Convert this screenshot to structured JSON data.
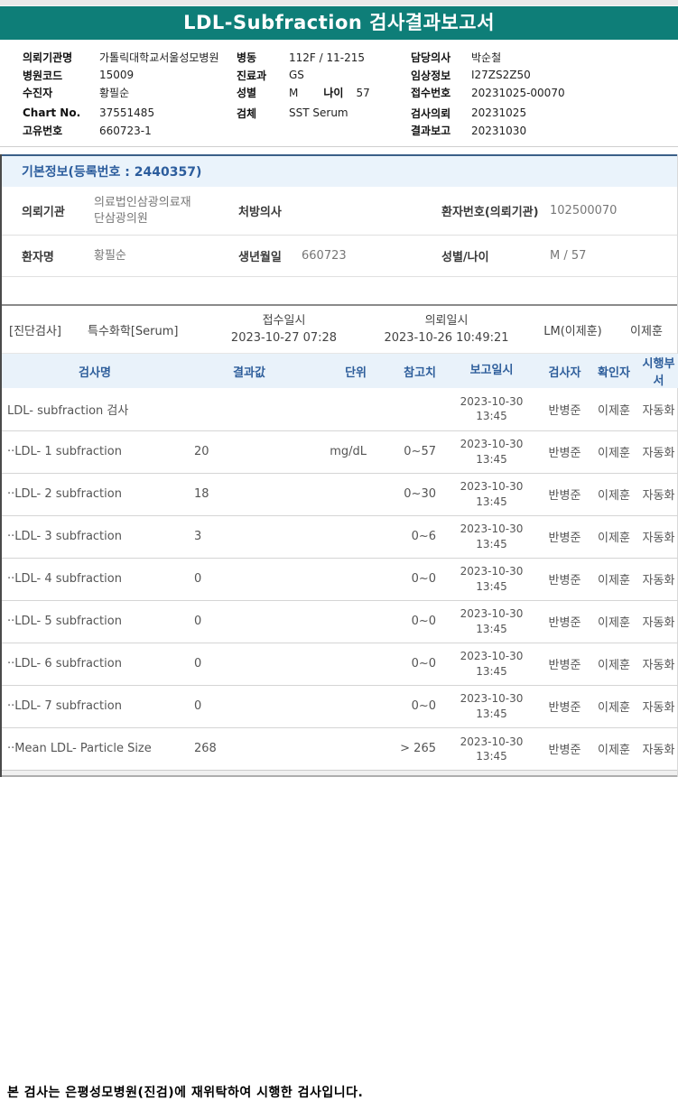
{
  "colors": {
    "teal_bar": "#0E7E78",
    "section_band_bg": "#EAF3FB",
    "section_band_text": "#2C5D9D",
    "table_header_bg": "#E9F2FA",
    "table_header_text": "#2E5E9B"
  },
  "title_bar": {
    "title": "LDL-Subfraction 검사결과보고서"
  },
  "patient_header": {
    "col1": [
      {
        "label": "의뢰기관명",
        "value": "가톨릭대학교서울성모병원"
      },
      {
        "label": "병원코드",
        "value": "15009"
      },
      {
        "label": "수진자",
        "value": "황필순"
      },
      {
        "label": "Chart No.",
        "value": "37551485"
      },
      {
        "label": "고유번호",
        "value": "660723-1"
      }
    ],
    "col2": [
      {
        "label": "병동",
        "value": "112F / 11-215"
      },
      {
        "label": "진료과",
        "value": "GS"
      },
      {
        "label": "성별",
        "value": "M",
        "label2": "나이",
        "value2": "57"
      },
      {
        "label": "검체",
        "value": "SST Serum"
      }
    ],
    "col3": [
      {
        "label": "담당의사",
        "value": "박순철"
      },
      {
        "label": "임상정보",
        "value": "I27ZS2Z50"
      },
      {
        "label": "접수번호",
        "value": "20231025-00070"
      },
      {
        "label": "검사의뢰",
        "value": "20231025"
      },
      {
        "label": "결과보고",
        "value": "20231030"
      }
    ]
  },
  "basic_info": {
    "section_title": "기본정보(등록번호 : 2440357)",
    "row1": {
      "label1": "의뢰기관",
      "value1": "의료법인삼광의료재\n단삼광의원",
      "label2": "처방의사",
      "value2": "",
      "label3": "환자번호(의뢰기관)",
      "value3": "102500070"
    },
    "row2": {
      "label1": "환자명",
      "value1": "황필순",
      "label2": "생년월일",
      "value2": "660723",
      "label3": "성별/나이",
      "value3": "M / 57"
    }
  },
  "order_row": {
    "category": "[진단검사]",
    "test_group": "특수화학[Serum]",
    "received": "접수일시\n2023-10-27 07:28",
    "requested": "의뢰일시\n2023-10-26 10:49:21",
    "department": "LM(이제훈)",
    "person": "이제훈"
  },
  "results_table": {
    "headers": {
      "name": "검사명",
      "result": "결과값",
      "unit": "단위",
      "reference": "참고치",
      "reported": "보고일시",
      "examiner": "검사자",
      "confirmer": "확인자",
      "department": "시행부서"
    },
    "rows": [
      {
        "name": "LDL- subfraction 검사",
        "result": "",
        "unit": "",
        "reference": "",
        "reported": "2023-10-30\n13:45",
        "examiner": "반병준",
        "confirmer": "이제훈",
        "department": "자동화"
      },
      {
        "name": "··LDL- 1 subfraction",
        "result": "20",
        "unit": "mg/dL",
        "reference": "0~57",
        "reported": "2023-10-30\n13:45",
        "examiner": "반병준",
        "confirmer": "이제훈",
        "department": "자동화"
      },
      {
        "name": "··LDL- 2 subfraction",
        "result": "18",
        "unit": "",
        "reference": "0~30",
        "reported": "2023-10-30\n13:45",
        "examiner": "반병준",
        "confirmer": "이제훈",
        "department": "자동화"
      },
      {
        "name": "··LDL- 3 subfraction",
        "result": "3",
        "unit": "",
        "reference": "0~6",
        "reported": "2023-10-30\n13:45",
        "examiner": "반병준",
        "confirmer": "이제훈",
        "department": "자동화"
      },
      {
        "name": "··LDL- 4 subfraction",
        "result": "0",
        "unit": "",
        "reference": "0~0",
        "reported": "2023-10-30\n13:45",
        "examiner": "반병준",
        "confirmer": "이제훈",
        "department": "자동화"
      },
      {
        "name": "··LDL- 5 subfraction",
        "result": "0",
        "unit": "",
        "reference": "0~0",
        "reported": "2023-10-30\n13:45",
        "examiner": "반병준",
        "confirmer": "이제훈",
        "department": "자동화"
      },
      {
        "name": "··LDL- 6 subfraction",
        "result": "0",
        "unit": "",
        "reference": "0~0",
        "reported": "2023-10-30\n13:45",
        "examiner": "반병준",
        "confirmer": "이제훈",
        "department": "자동화"
      },
      {
        "name": "··LDL- 7 subfraction",
        "result": "0",
        "unit": "",
        "reference": "0~0",
        "reported": "2023-10-30\n13:45",
        "examiner": "반병준",
        "confirmer": "이제훈",
        "department": "자동화"
      },
      {
        "name": "··Mean LDL- Particle Size",
        "result": "268",
        "unit": "",
        "reference": "> 265",
        "reported": "2023-10-30\n13:45",
        "examiner": "반병준",
        "confirmer": "이제훈",
        "department": "자동화"
      }
    ]
  },
  "footer": {
    "note": "본 검사는 은평성모병원(진검)에 재위탁하여 시행한 검사입니다."
  }
}
